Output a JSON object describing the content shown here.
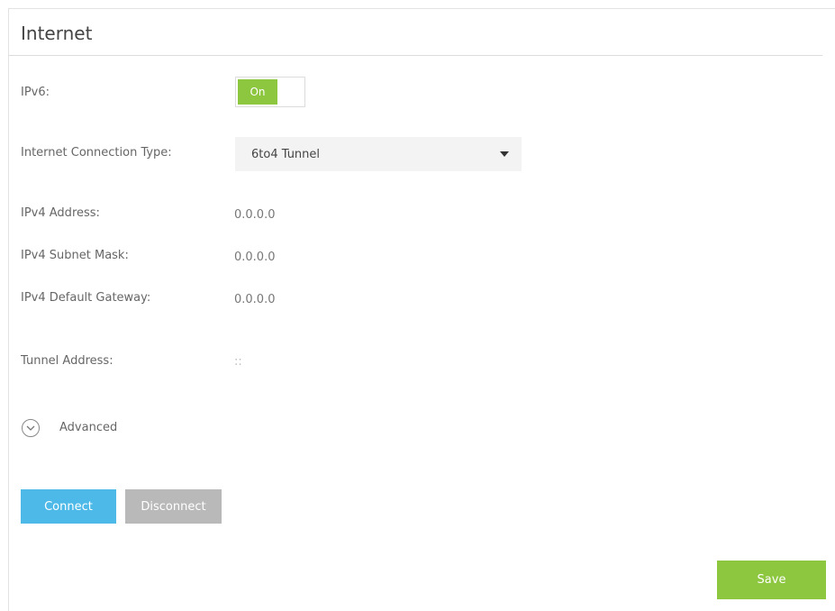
{
  "section": {
    "title": "Internet"
  },
  "ipv6": {
    "label": "IPv6:",
    "toggle_label": "On",
    "toggle_state": "on"
  },
  "connection_type": {
    "label": "Internet Connection Type:",
    "selected": "6to4 Tunnel"
  },
  "fields": {
    "ipv4_address": {
      "label": "IPv4 Address:",
      "value": "0.0.0.0"
    },
    "ipv4_subnet_mask": {
      "label": "IPv4 Subnet Mask:",
      "value": "0.0.0.0"
    },
    "ipv4_default_gateway": {
      "label": "IPv4 Default Gateway:",
      "value": "0.0.0.0"
    },
    "tunnel_address": {
      "label": "Tunnel Address:",
      "value": "::"
    }
  },
  "advanced": {
    "label": "Advanced",
    "icon": "chevron-down-circle-icon"
  },
  "buttons": {
    "connect": "Connect",
    "disconnect": "Disconnect",
    "save": "Save"
  },
  "colors": {
    "toggle_on": "#8dc63f",
    "connect": "#4cb9e8",
    "disconnect": "#b9b9b9",
    "save": "#8dc63f"
  }
}
